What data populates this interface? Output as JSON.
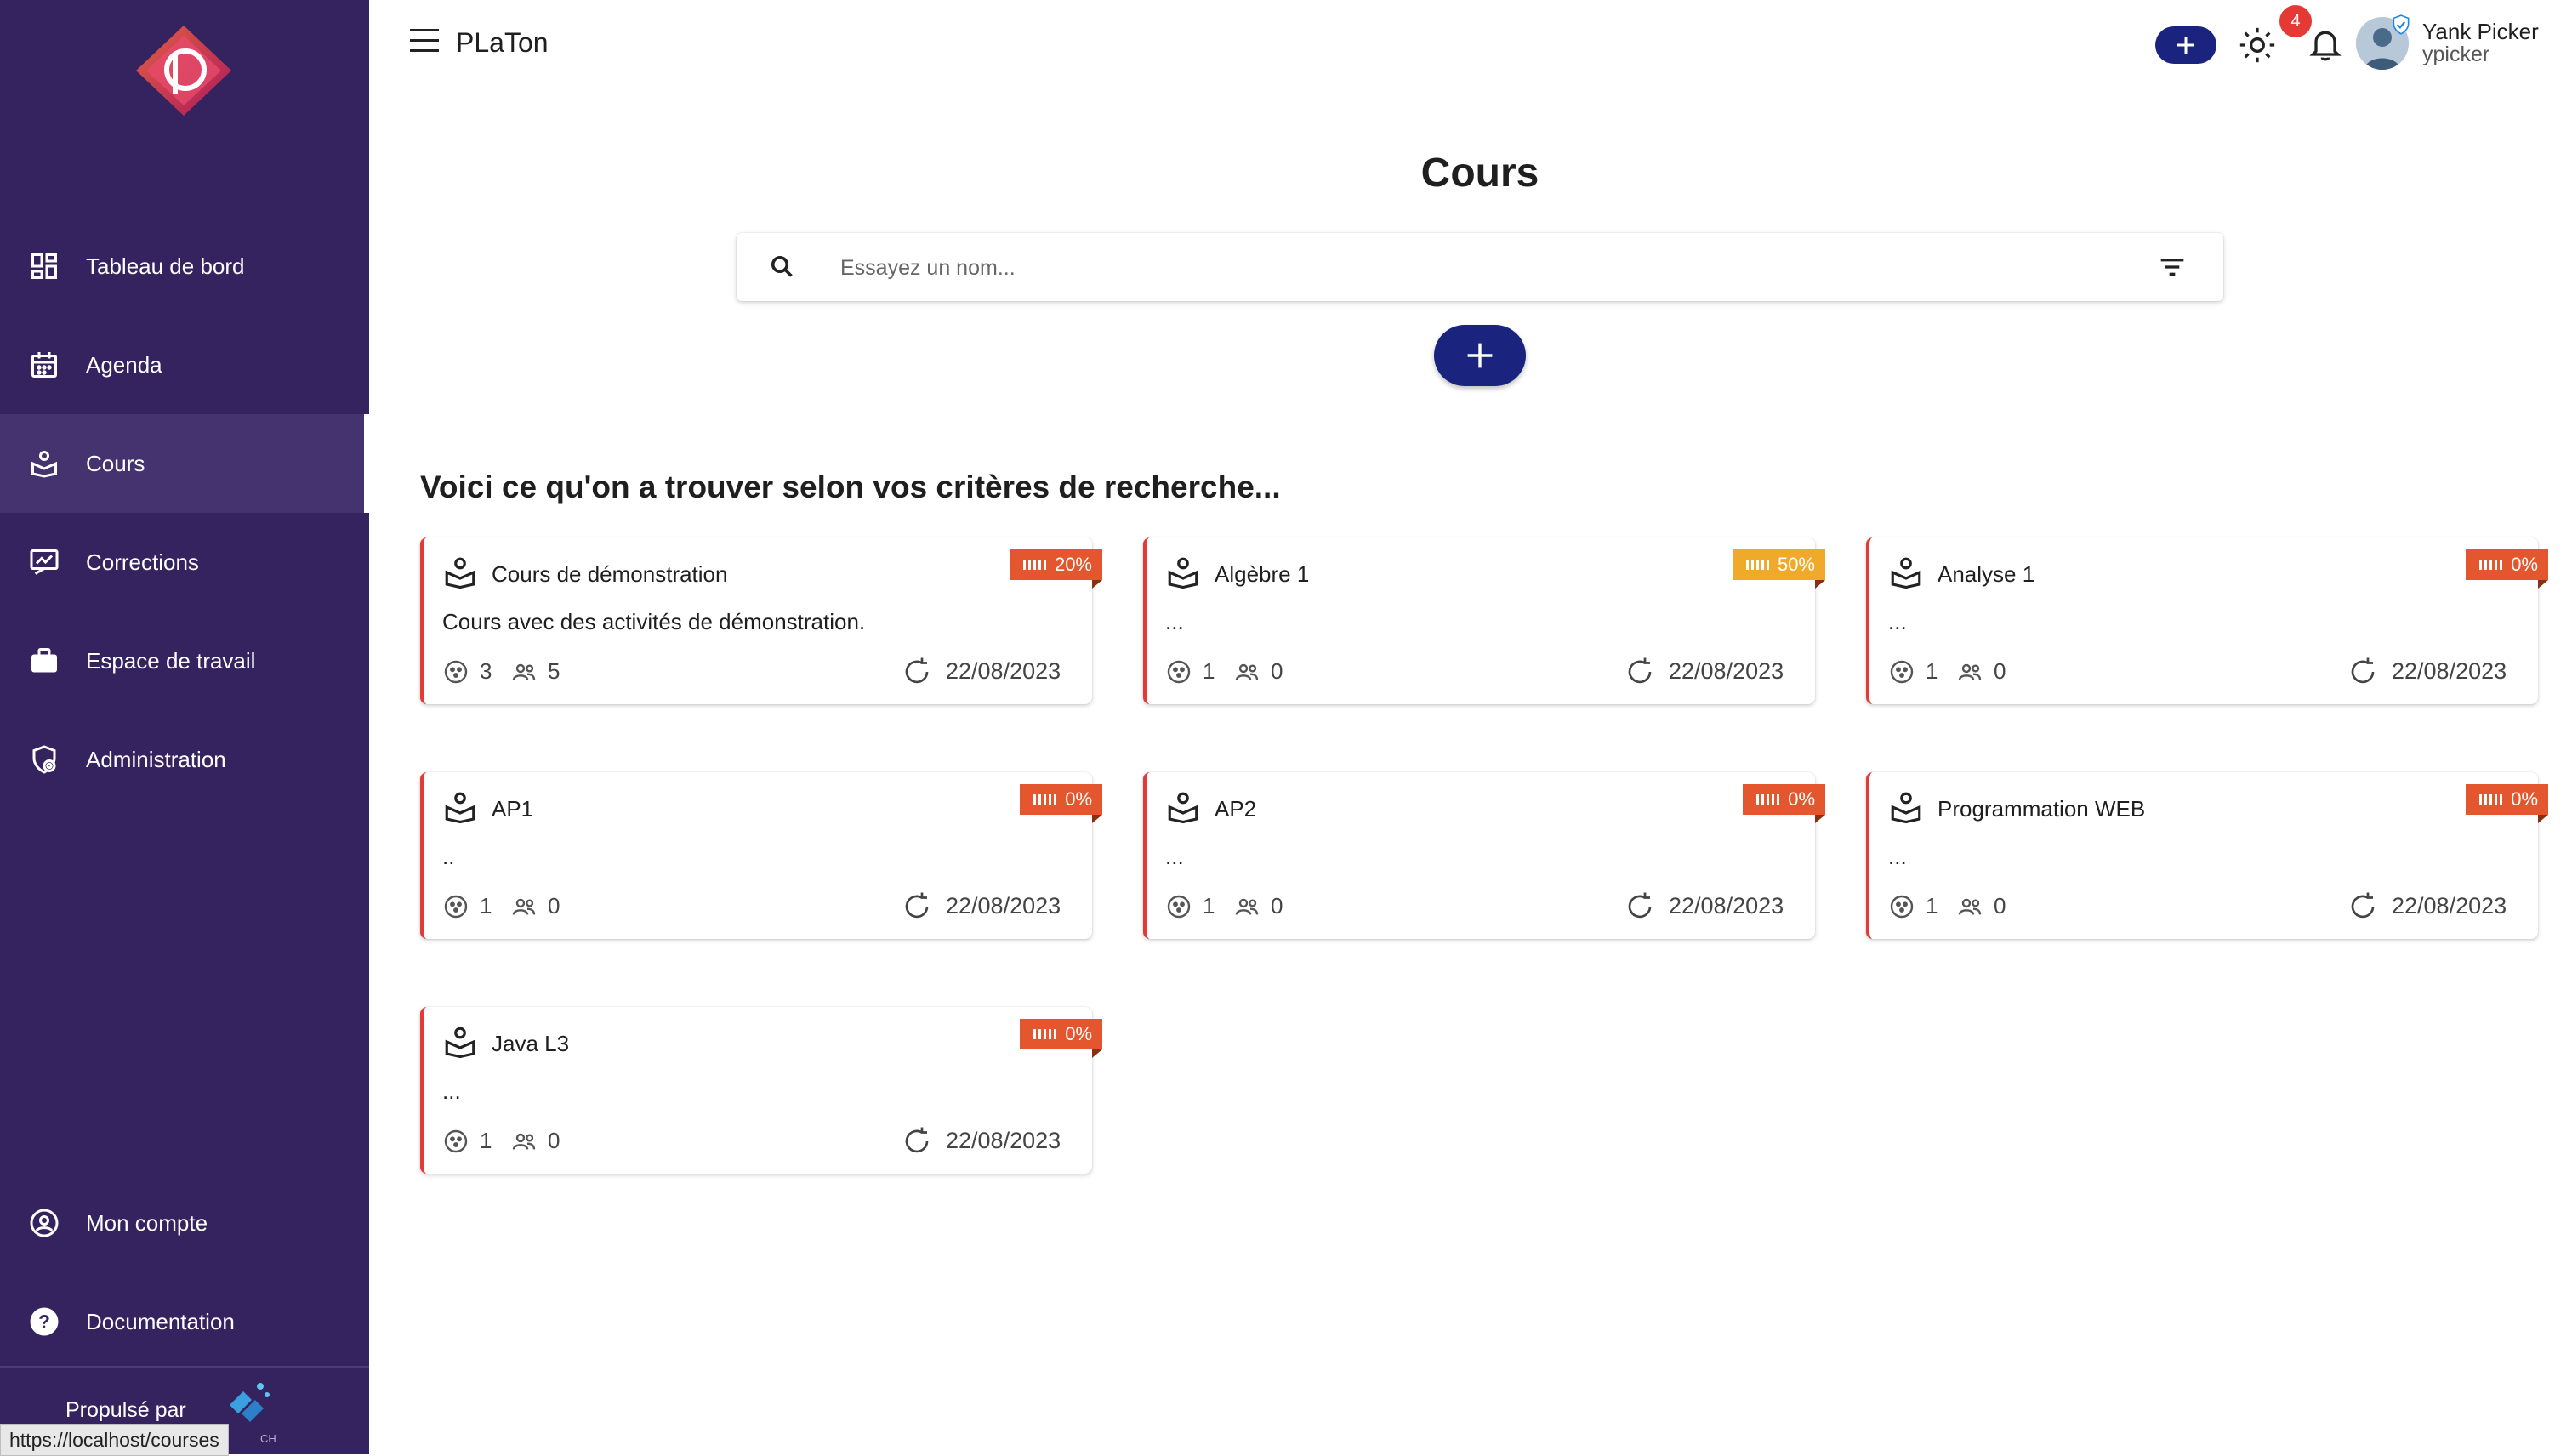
{
  "app": {
    "title": "PLaTon"
  },
  "sidebar": {
    "items": [
      {
        "label": "Tableau de bord",
        "icon": "dashboard-icon"
      },
      {
        "label": "Agenda",
        "icon": "calendar-icon"
      },
      {
        "label": "Cours",
        "icon": "course-icon",
        "active": true
      },
      {
        "label": "Corrections",
        "icon": "corrections-icon"
      },
      {
        "label": "Espace de travail",
        "icon": "briefcase-icon"
      },
      {
        "label": "Administration",
        "icon": "admin-icon"
      }
    ],
    "bottom_items": [
      {
        "label": "Mon compte",
        "icon": "account-icon"
      },
      {
        "label": "Documentation",
        "icon": "help-icon"
      }
    ],
    "powered_by": "Propulsé par",
    "url_tooltip": "https://localhost/courses",
    "url_tooltip_suffix": "CH"
  },
  "header": {
    "notifications_count": "4",
    "user": {
      "name": "Yank Picker",
      "login": "ypicker"
    }
  },
  "main": {
    "title": "Cours",
    "search": {
      "placeholder": "Essayez un nom..."
    },
    "results_title": "Voici ce qu'on a trouver selon vos critères de recherche..."
  },
  "colors": {
    "sidebar": "#35235f",
    "primary": "#1a237e",
    "progress_low": "#e4572e",
    "progress_mid": "#f0a92b",
    "card_accent": "#e53935"
  },
  "courses": [
    {
      "name": "Cours de démonstration",
      "description": "Cours avec des activités de démonstration.",
      "progress": "20%",
      "level": "low",
      "activities": "3",
      "members": "5",
      "date": "22/08/2023"
    },
    {
      "name": "Algèbre 1",
      "description": "...",
      "progress": "50%",
      "level": "mid",
      "activities": "1",
      "members": "0",
      "date": "22/08/2023"
    },
    {
      "name": "Analyse 1",
      "description": "...",
      "progress": "0%",
      "level": "low",
      "activities": "1",
      "members": "0",
      "date": "22/08/2023"
    },
    {
      "name": "AP1",
      "description": "..",
      "progress": "0%",
      "level": "low",
      "activities": "1",
      "members": "0",
      "date": "22/08/2023"
    },
    {
      "name": "AP2",
      "description": "...",
      "progress": "0%",
      "level": "low",
      "activities": "1",
      "members": "0",
      "date": "22/08/2023"
    },
    {
      "name": "Programmation WEB",
      "description": "...",
      "progress": "0%",
      "level": "low",
      "activities": "1",
      "members": "0",
      "date": "22/08/2023"
    },
    {
      "name": "Java L3",
      "description": "...",
      "progress": "0%",
      "level": "low",
      "activities": "1",
      "members": "0",
      "date": "22/08/2023"
    }
  ]
}
